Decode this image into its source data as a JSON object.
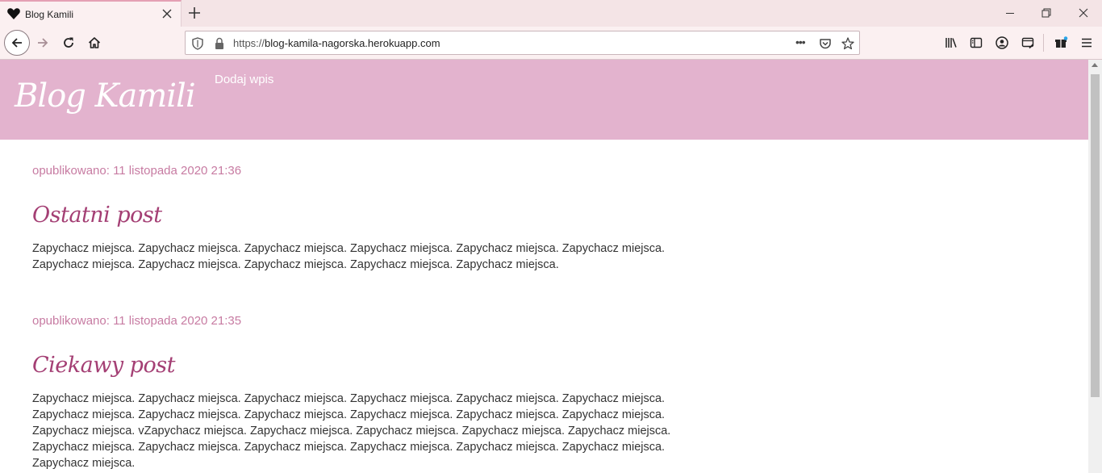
{
  "browser": {
    "tab_title": "Blog Kamili",
    "url_prefix": "https://",
    "url_host": "blog-kamila-nagorska.herokuapp.com",
    "url_menu": "•••"
  },
  "page": {
    "blog_title": "Blog Kamili",
    "add_post_link": "Dodaj wpis",
    "posts": [
      {
        "date": "opublikowano: 11 listopada 2020 21:36",
        "title": "Ostatni post",
        "lines": [
          "Zapychacz miejsca. Zapychacz miejsca. Zapychacz miejsca. Zapychacz miejsca. Zapychacz miejsca. Zapychacz miejsca.",
          "Zapychacz miejsca. Zapychacz miejsca. Zapychacz miejsca. Zapychacz miejsca. Zapychacz miejsca."
        ]
      },
      {
        "date": "opublikowano: 11 listopada 2020 21:35",
        "title": "Ciekawy post",
        "lines": [
          "Zapychacz miejsca. Zapychacz miejsca. Zapychacz miejsca. Zapychacz miejsca. Zapychacz miejsca. Zapychacz miejsca.",
          "Zapychacz miejsca. Zapychacz miejsca. Zapychacz miejsca. Zapychacz miejsca. Zapychacz miejsca. Zapychacz miejsca.",
          "Zapychacz miejsca. vZapychacz miejsca. Zapychacz miejsca. Zapychacz miejsca. Zapychacz miejsca. Zapychacz miejsca.",
          "Zapychacz miejsca. Zapychacz miejsca. Zapychacz miejsca. Zapychacz miejsca. Zapychacz miejsca. Zapychacz miejsca.",
          "Zapychacz miejsca."
        ]
      }
    ]
  },
  "colors": {
    "header_bg": "#e3b3ce",
    "date_color": "#c77ba2",
    "title_color": "#a43f74"
  }
}
